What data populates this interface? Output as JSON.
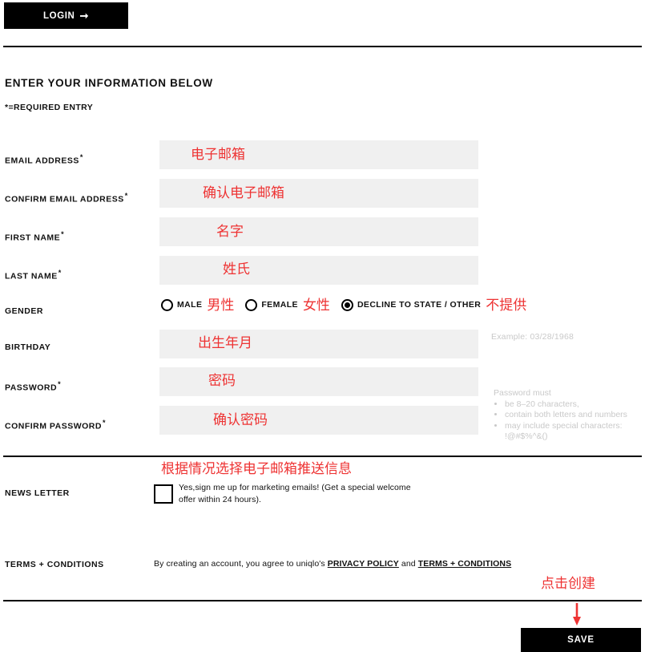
{
  "login": {
    "label": "LOGIN",
    "arrow_icon": "arrow-right-icon"
  },
  "section": {
    "heading": "ENTER YOUR INFORMATION BELOW",
    "required_note": "*=REQUIRED ENTRY"
  },
  "fields": [
    {
      "label": "EMAIL ADDRESS",
      "required": "*",
      "value": "",
      "annotation": "电子邮箱"
    },
    {
      "label": "CONFIRM EMAIL ADDRESS",
      "required": "*",
      "value": "",
      "annotation": "确认电子邮箱"
    },
    {
      "label": "FIRST NAME",
      "required": "*",
      "value": "",
      "annotation": "名字"
    },
    {
      "label": "LAST NAME",
      "required": "*",
      "value": "",
      "annotation": "姓氏"
    }
  ],
  "gender": {
    "label": "GENDER",
    "options": [
      {
        "label": "MALE",
        "annotation": "男性",
        "selected": false
      },
      {
        "label": "FEMALE",
        "annotation": "女性",
        "selected": false
      },
      {
        "label": "DECLINE TO STATE / OTHER",
        "annotation": "不提供",
        "selected": true
      }
    ]
  },
  "birthday": {
    "label": "BIRTHDAY",
    "required": "",
    "value": "",
    "annotation": "出生年月",
    "example": "Example: 03/28/1968"
  },
  "password": {
    "label": "PASSWORD",
    "required": "*",
    "value": "",
    "annotation": "密码"
  },
  "confirm_password": {
    "label": "CONFIRM PASSWORD",
    "required": "*",
    "value": "",
    "annotation": "确认密码"
  },
  "password_rules": {
    "title": "Password must",
    "items": [
      "be 8–20 characters,",
      "contain both letters and numbers",
      "may include special characters: !@#$%^&()"
    ]
  },
  "newsletter": {
    "label": "NEWS LETTER",
    "annotation": "根据情况选择电子邮箱推送信息",
    "checked": false,
    "text": "Yes,sign me up for marketing emails! (Get a special welcome offer within 24 hours)."
  },
  "terms": {
    "label": "TERMS + CONDITIONS",
    "text_before": "By creating an account, you agree to uniqlo's ",
    "privacy_link": "PRIVACY POLICY",
    "text_middle": " and ",
    "terms_link": "TERMS + CONDITIONS"
  },
  "save": {
    "label": "SAVE",
    "annotation": "点击创建",
    "arrow_icon": "arrow-down-icon"
  },
  "colors": {
    "accent_red": "#ee3333",
    "field_bg": "#f0f0f0",
    "button_bg": "#000000",
    "hint_gray": "#c9c9c9"
  }
}
